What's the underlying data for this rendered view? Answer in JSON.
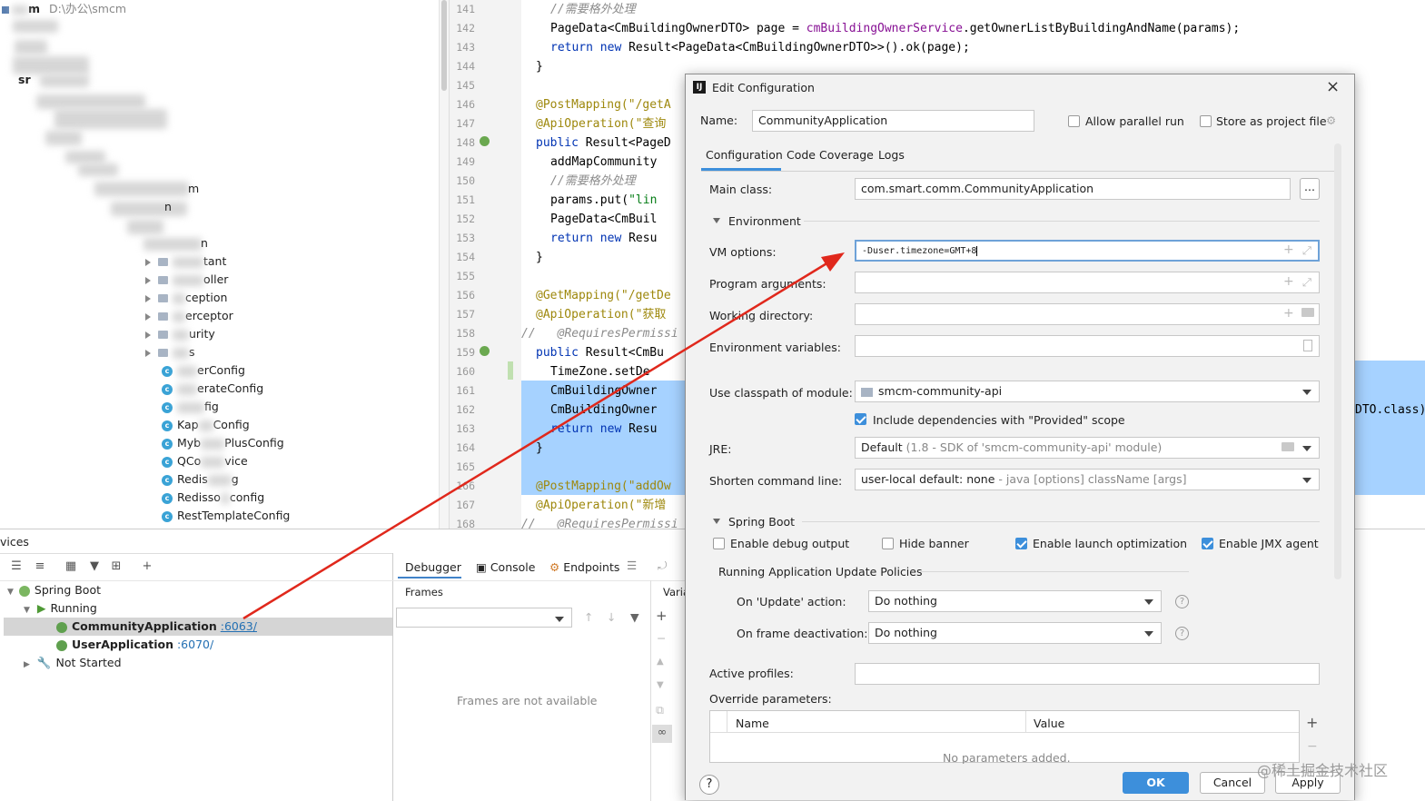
{
  "project": {
    "root_label": "m",
    "root_path": "D:\\办公\\smcm",
    "items": [
      {
        "label": "tant"
      },
      {
        "label": "oller"
      },
      {
        "label": "ception"
      },
      {
        "label": "erceptor"
      },
      {
        "label": "urity"
      },
      {
        "label": "s"
      }
    ],
    "classes": [
      {
        "label": "erConfig"
      },
      {
        "label": "erateConfig"
      },
      {
        "label": "fig"
      },
      {
        "label": "Kap"
      },
      {
        "label": "Config"
      },
      {
        "label": "Myb"
      },
      {
        "label": "PlusConfig"
      },
      {
        "label": "QCo"
      },
      {
        "label": "vice"
      },
      {
        "label": "Redis"
      },
      {
        "label": "g"
      },
      {
        "label": "Redisso"
      },
      {
        "label": "config"
      },
      {
        "label": "RestTemplateConfig"
      }
    ],
    "misc": {
      "a": "sr",
      "b": "m",
      "c": "n",
      "d": "n"
    }
  },
  "editor": {
    "line_numbers": [
      "141",
      "142",
      "143",
      "144",
      "145",
      "146",
      "147",
      "148",
      "149",
      "150",
      "151",
      "152",
      "153",
      "154",
      "155",
      "156",
      "157",
      "158",
      "159",
      "160",
      "161",
      "162",
      "163",
      "164",
      "165",
      "166",
      "167",
      "168"
    ],
    "lines": {
      "l141": "//需要格外处理",
      "l142a": "PageData<CmBuildingOwnerDTO> page = ",
      "l142b": "cmBuildingOwnerService",
      "l142c": ".getOwnerListByBuildingAndName(params);",
      "l143a": "return new ",
      "l143b": "Result<PageData<CmBuildingOwnerDTO>>().ok(page);",
      "l144": "}",
      "l146": "@PostMapping(\"/getA",
      "l147": "@ApiOperation(\"查询",
      "l148a": "public ",
      "l148b": "Result<PageD",
      "l149": "addMapCommunity",
      "l150": "//需要格外处理",
      "l151a": "params.put(",
      "l151b": "\"lin",
      "l152": "PageData<CmBuil",
      "l153a": "return new ",
      "l153b": "Resu",
      "l154": "}",
      "l156": "@GetMapping(\"/getDe",
      "l157": "@ApiOperation(\"获取",
      "l158a": "//",
      "l158b": "@RequiresPermissi",
      "l159a": "public ",
      "l159b": "Result<CmBu",
      "l160": "TimeZone.setDe",
      "l161": "CmBuildingOwner",
      "l162": "CmBuildingOwner",
      "l163a": "return new ",
      "l163b": "Resu",
      "l164": "}",
      "l166": "@PostMapping(\"addOw",
      "l167": "@ApiOperation(\"新增",
      "l168a": "//",
      "l168b": "@RequiresPermissi",
      "right_fragment": "DTO.class)"
    }
  },
  "services": {
    "title": "vices",
    "tree": {
      "spring_boot": "Spring Boot",
      "running": "Running",
      "app1_name": "CommunityApplication",
      "app1_port": ":6063/",
      "app2_name": "UserApplication",
      "app2_port": ":6070/",
      "not_started": "Not Started"
    },
    "tabs": {
      "debugger": "Debugger",
      "console": "Console",
      "endpoints": "Endpoints"
    },
    "frames_label": "Frames",
    "variables_label": "Varia",
    "frames_empty": "Frames are not available"
  },
  "dialog": {
    "title": "Edit Configuration",
    "name_label": "Name:",
    "name_value": "CommunityApplication",
    "allow_parallel": "Allow parallel run",
    "store_project": "Store as project file",
    "tabs": [
      "Configuration",
      "Code Coverage",
      "Logs"
    ],
    "main_class_label": "Main class:",
    "main_class_value": "com.smart.comm.CommunityApplication",
    "environment_label": "Environment",
    "vm_options_label": "VM options:",
    "vm_options_value": "-Duser.timezone=GMT+8",
    "program_args_label": "Program arguments:",
    "working_dir_label": "Working directory:",
    "env_vars_label": "Environment variables:",
    "classpath_label": "Use classpath of module:",
    "classpath_value": "smcm-community-api",
    "include_deps": "Include dependencies with \"Provided\" scope",
    "jre_label": "JRE:",
    "jre_value": "Default",
    "jre_detail": "(1.8 - SDK of 'smcm-community-api' module)",
    "shorten_label": "Shorten command line:",
    "shorten_value": "user-local default: none",
    "shorten_detail": "- java [options] className [args]",
    "spring_boot_label": "Spring Boot",
    "debug_output": "Enable debug output",
    "hide_banner": "Hide banner",
    "launch_opt": "Enable launch optimization",
    "jmx_agent": "Enable JMX agent",
    "update_policies": "Running Application Update Policies",
    "on_update_label": "On 'Update' action:",
    "on_update_value": "Do nothing",
    "on_frame_label": "On frame deactivation:",
    "on_frame_value": "Do nothing",
    "active_profiles_label": "Active profiles:",
    "override_label": "Override parameters:",
    "table_name_col": "Name",
    "table_value_col": "Value",
    "table_empty": "No parameters added.",
    "ok_label": "OK",
    "cancel_label": "Cancel",
    "apply_label": "Apply",
    "browse_label": "...",
    "help_glyph": "?"
  },
  "watermark": "@稀土掘金技术社区",
  "colors": {
    "accent": "#3d8fdb",
    "selection": "#a6d2ff",
    "arrow": "#e0281c"
  }
}
